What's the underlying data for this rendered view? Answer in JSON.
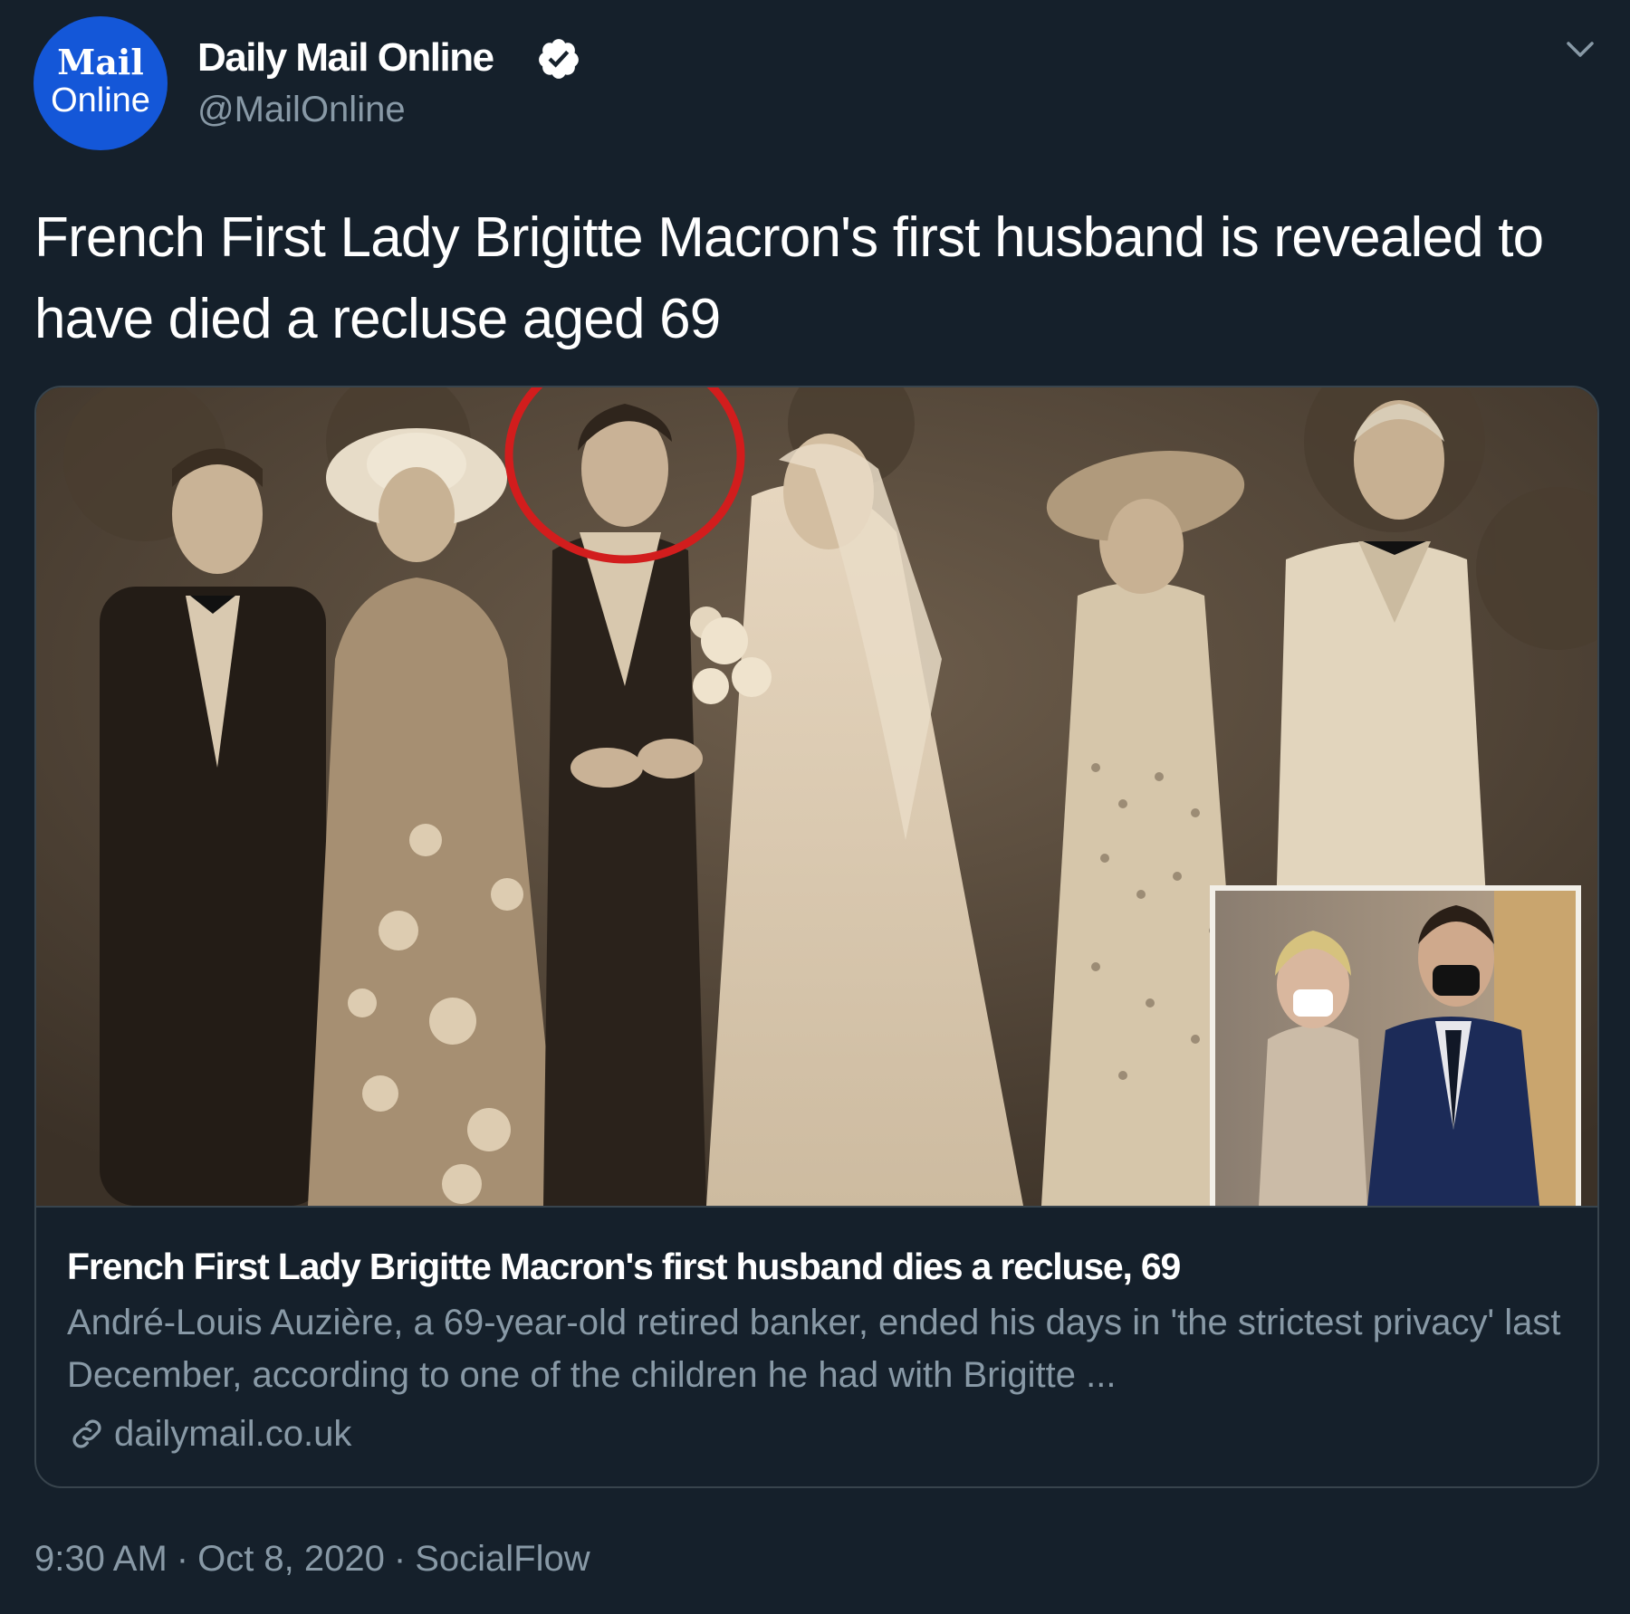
{
  "author": {
    "name": "Daily Mail Online",
    "handle": "@MailOnline",
    "avatar_text_top": "Mail",
    "avatar_text_bottom": "Online",
    "avatar_color": "#1457d8",
    "verified": true,
    "verified_icon": "verified-badge-icon"
  },
  "tweet": {
    "text": "French First Lady Brigitte Macron's first husband is revealed to have died a recluse aged 69"
  },
  "card": {
    "title": "French First Lady Brigitte Macron's first husband dies a recluse, 69",
    "description": "André-Louis Auzière, a 69-year-old retired banker, ended his days in 'the strictest privacy' last December, according to one of the children he had with Brigitte ...",
    "domain": "dailymail.co.uk",
    "link_icon": "link-icon",
    "image_alt": "Vintage sepia wedding photo with groom circled in red; inset photo of a couple in face masks"
  },
  "meta": {
    "time": "9:30 AM",
    "separator": "·",
    "date": "Oct 8, 2020",
    "source": "SocialFlow"
  },
  "colors": {
    "background": "#15202b",
    "text_primary": "#ffffff",
    "text_secondary": "#8899a6",
    "border": "#38444d",
    "highlight_circle": "#d21d1d"
  }
}
